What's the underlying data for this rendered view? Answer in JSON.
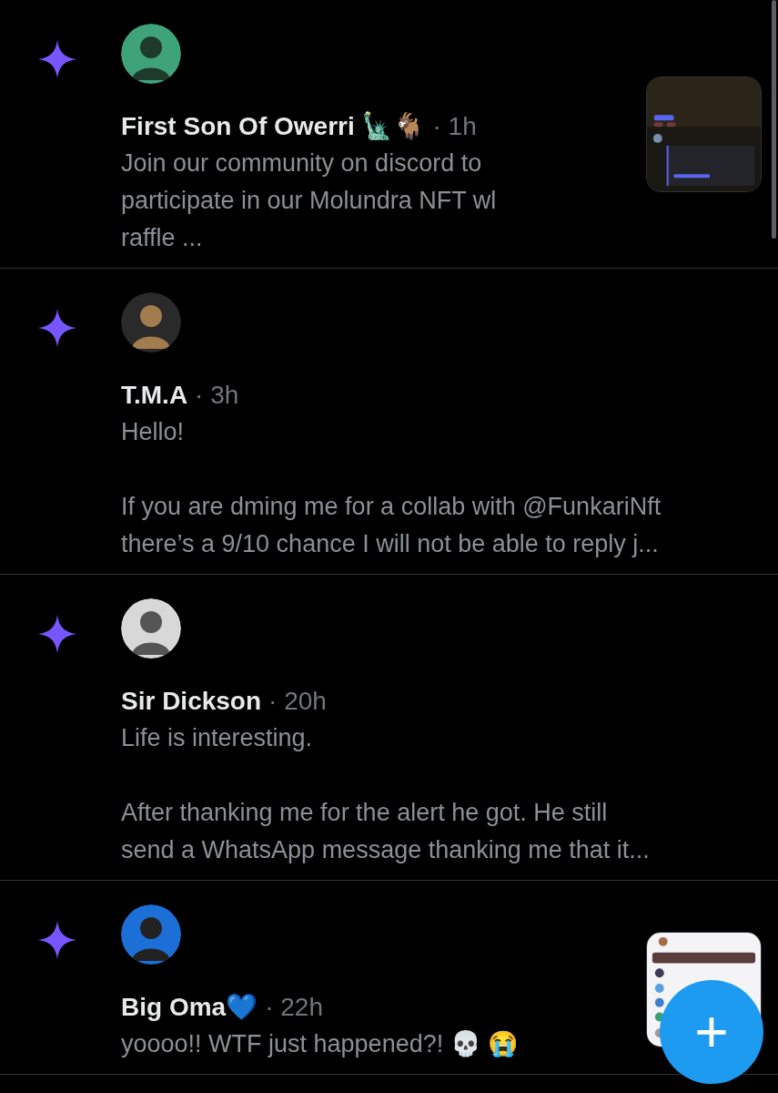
{
  "posts": [
    {
      "name": "First Son Of Owerri 🗽🐐",
      "time": "· 1h",
      "body": "Join our community on discord to\nparticipate in our Molundra NFT wl\nraffle ..."
    },
    {
      "name": "T.M.A",
      "time": "· 3h",
      "body": "Hello!\n\nIf you are dming me for a collab with @FunkariNft\nthere’s a 9/10 chance I will not be able to reply j..."
    },
    {
      "name": "Sir Dickson",
      "time": "· 20h",
      "body": "Life is interesting.\n\nAfter thanking me for the alert he got. He still\nsend a WhatsApp message thanking me that it..."
    },
    {
      "name": "Big Oma💙",
      "time": "· 22h",
      "body": "yoooo!! WTF just happened?! 💀 😭"
    }
  ],
  "compose_button": {
    "label": "+"
  }
}
